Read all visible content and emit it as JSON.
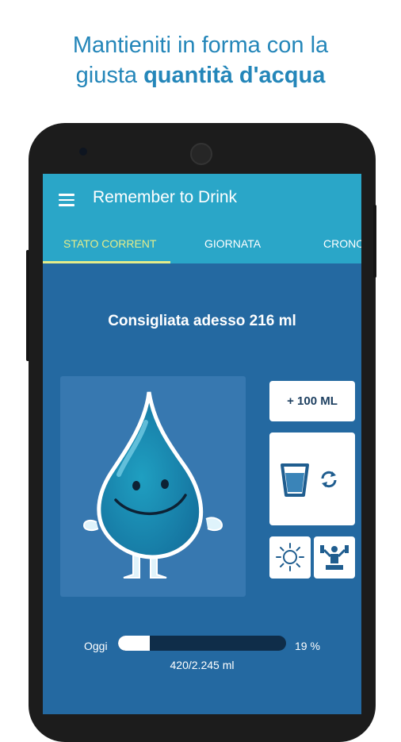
{
  "promo": {
    "line1": "Mantieniti in forma con la",
    "line2_regular": "giusta ",
    "line2_bold": "quantità d'acqua"
  },
  "app": {
    "title": "Remember to Drink",
    "menu_icon": "hamburger-menu-icon",
    "bar_color": "#2aa6c8",
    "background_color": "#2469a1",
    "accent_color": "#e4ed8a"
  },
  "tabs": [
    {
      "label": "STATO CORRENT",
      "active": true
    },
    {
      "label": "GIORNATA",
      "active": false
    },
    {
      "label": "CRONO",
      "active": false
    }
  ],
  "recommendation": "Consigliata adesso 216 ml",
  "mascot": "water-drop-mascot",
  "actions": {
    "add_label": "+ 100 ML",
    "glass_icon": "glass-icon",
    "swap_icon": "swap-arrows-icon",
    "weather_icon": "sun-icon",
    "activity_icon": "fitness-icon"
  },
  "progress": {
    "label": "Oggi",
    "percent_text": "19 %",
    "fraction": 0.19,
    "amount": "420/2.245 ml"
  }
}
